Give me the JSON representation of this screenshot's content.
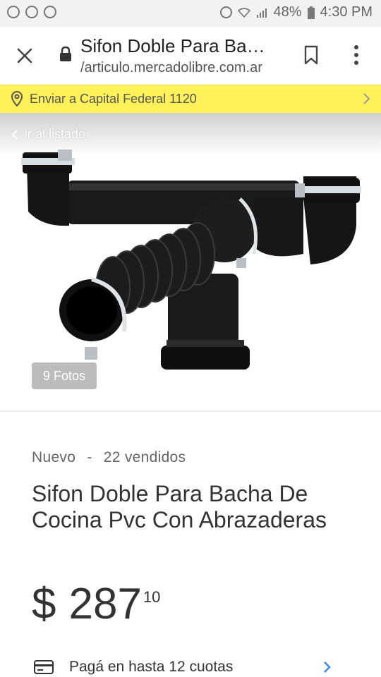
{
  "status_bar": {
    "battery": "48%",
    "time": "4:30 PM",
    "icons": [
      "whatsapp-icon",
      "soccer-icon",
      "account-icon",
      "alarm-icon",
      "wifi-icon",
      "signal-icon",
      "battery-icon"
    ]
  },
  "url_bar": {
    "title": "Sifon Doble Para Ba…",
    "domain": "articulo.mercadolibre.com.ar",
    "domain_prefix": "/",
    "icons": [
      "close-icon",
      "lock-icon",
      "bookmark-icon",
      "menu-icon"
    ]
  },
  "shipping_bar": {
    "text": "Enviar a Capital Federal 1120",
    "color": "#fff159"
  },
  "gallery": {
    "back_label": "Ir al listado",
    "photos_label": "9 Fotos"
  },
  "product": {
    "condition": "Nuevo",
    "separator": "-",
    "sold": "22 vendidos",
    "title": "Sifon Doble Para Bacha De Cocina Pvc Con Abrazaderas",
    "price": {
      "symbol": "$",
      "integer": "287",
      "cents": "10"
    },
    "installments": "Pagá en hasta 12 cuotas",
    "accent_color": "#3483fa"
  }
}
